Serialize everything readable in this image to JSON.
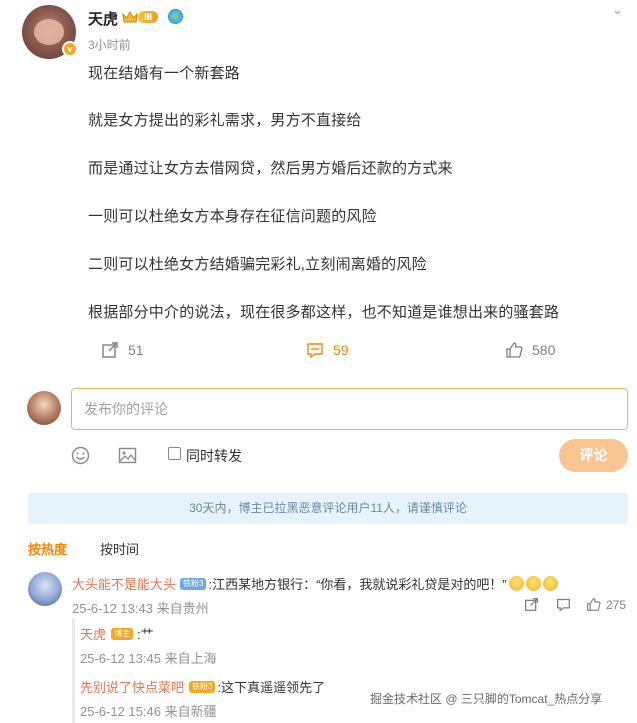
{
  "post": {
    "username": "天虎",
    "level_badge": "Ⅲ",
    "time_ago": "3小时前",
    "paragraphs": [
      "现在结婚有一个新套路",
      "就是女方提出的彩礼需求，男方不直接给",
      "而是通过让女方去借网贷，然后男方婚后还款的方式来",
      "一则可以杜绝女方本身存在征信问题的风险",
      "二则可以杜绝女方结婚骗完彩礼,立刻闹离婚的风险",
      "根据部分中介的说法，现在很多都这样，也不知道是谁想出来的骚套路"
    ],
    "actions": {
      "repost_count": "51",
      "comment_count": "59",
      "like_count": "580"
    }
  },
  "compose": {
    "placeholder": "发布你的评论",
    "repost_label": "同时转发",
    "submit_label": "评论"
  },
  "notice": "30天内，博主已拉黑恶意评论用户11人，请谨慎评论",
  "sort_tabs": {
    "hot": "按热度",
    "time": "按时间"
  },
  "comments": [
    {
      "name": "大头能不是能大头",
      "badge": "铁粉3",
      "text": ":江西某地方银行：“你看，我就说彩礼贷是对的吧！”",
      "meta": "25-6-12 13:43 来自贵州",
      "like_count": "275",
      "replies": [
        {
          "name": "天虎",
          "badge": "博主",
          "text": ":艹",
          "meta": "25-6-12 13:45 来自上海"
        },
        {
          "name": "先别说了快点菜吧",
          "badge": "铁粉3",
          "text": ":这下真遥遥领先了",
          "meta": "25-6-12 15:46 来自新疆"
        }
      ]
    }
  ],
  "watermark": "掘金技术社区 @ 三只脚的Tomcat_热点分享",
  "colors": {
    "accent": "#ff8200",
    "username_link": "#eb7350",
    "notice_bg": "#e6f3fb",
    "submit_bg": "#fbc592"
  },
  "icons": [
    "verified-v-icon",
    "crown-icon",
    "globe-icon",
    "chevron-down-icon",
    "repost-icon",
    "comment-icon",
    "like-icon",
    "emoji-icon",
    "image-icon"
  ]
}
